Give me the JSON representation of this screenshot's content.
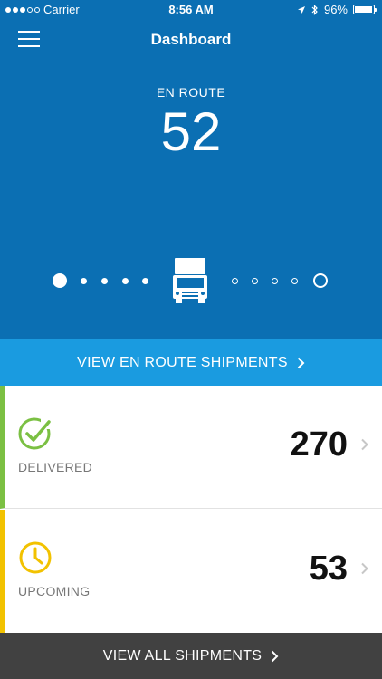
{
  "status_bar": {
    "carrier": "Carrier",
    "time": "8:56 AM",
    "battery": "96%",
    "battery_level": 0.96
  },
  "header": {
    "title": "Dashboard",
    "menu_icon": "hamburger-menu-icon"
  },
  "hero": {
    "label": "EN ROUTE",
    "count": "52",
    "truck_icon": "truck-icon",
    "progress": {
      "filled_dots": 4,
      "empty_dots": 4
    }
  },
  "actions": {
    "en_route_label": "VIEW EN ROUTE SHIPMENTS",
    "all_label": "VIEW ALL SHIPMENTS"
  },
  "cards": [
    {
      "label": "DELIVERED",
      "count": "270",
      "icon": "check-circle-icon",
      "accent": "#7bc043"
    },
    {
      "label": "UPCOMING",
      "count": "53",
      "icon": "clock-icon",
      "accent": "#f2c200"
    }
  ],
  "colors": {
    "hero_bg": "#0b6fb3",
    "en_route_button": "#1a9be0",
    "all_button": "#414141"
  }
}
